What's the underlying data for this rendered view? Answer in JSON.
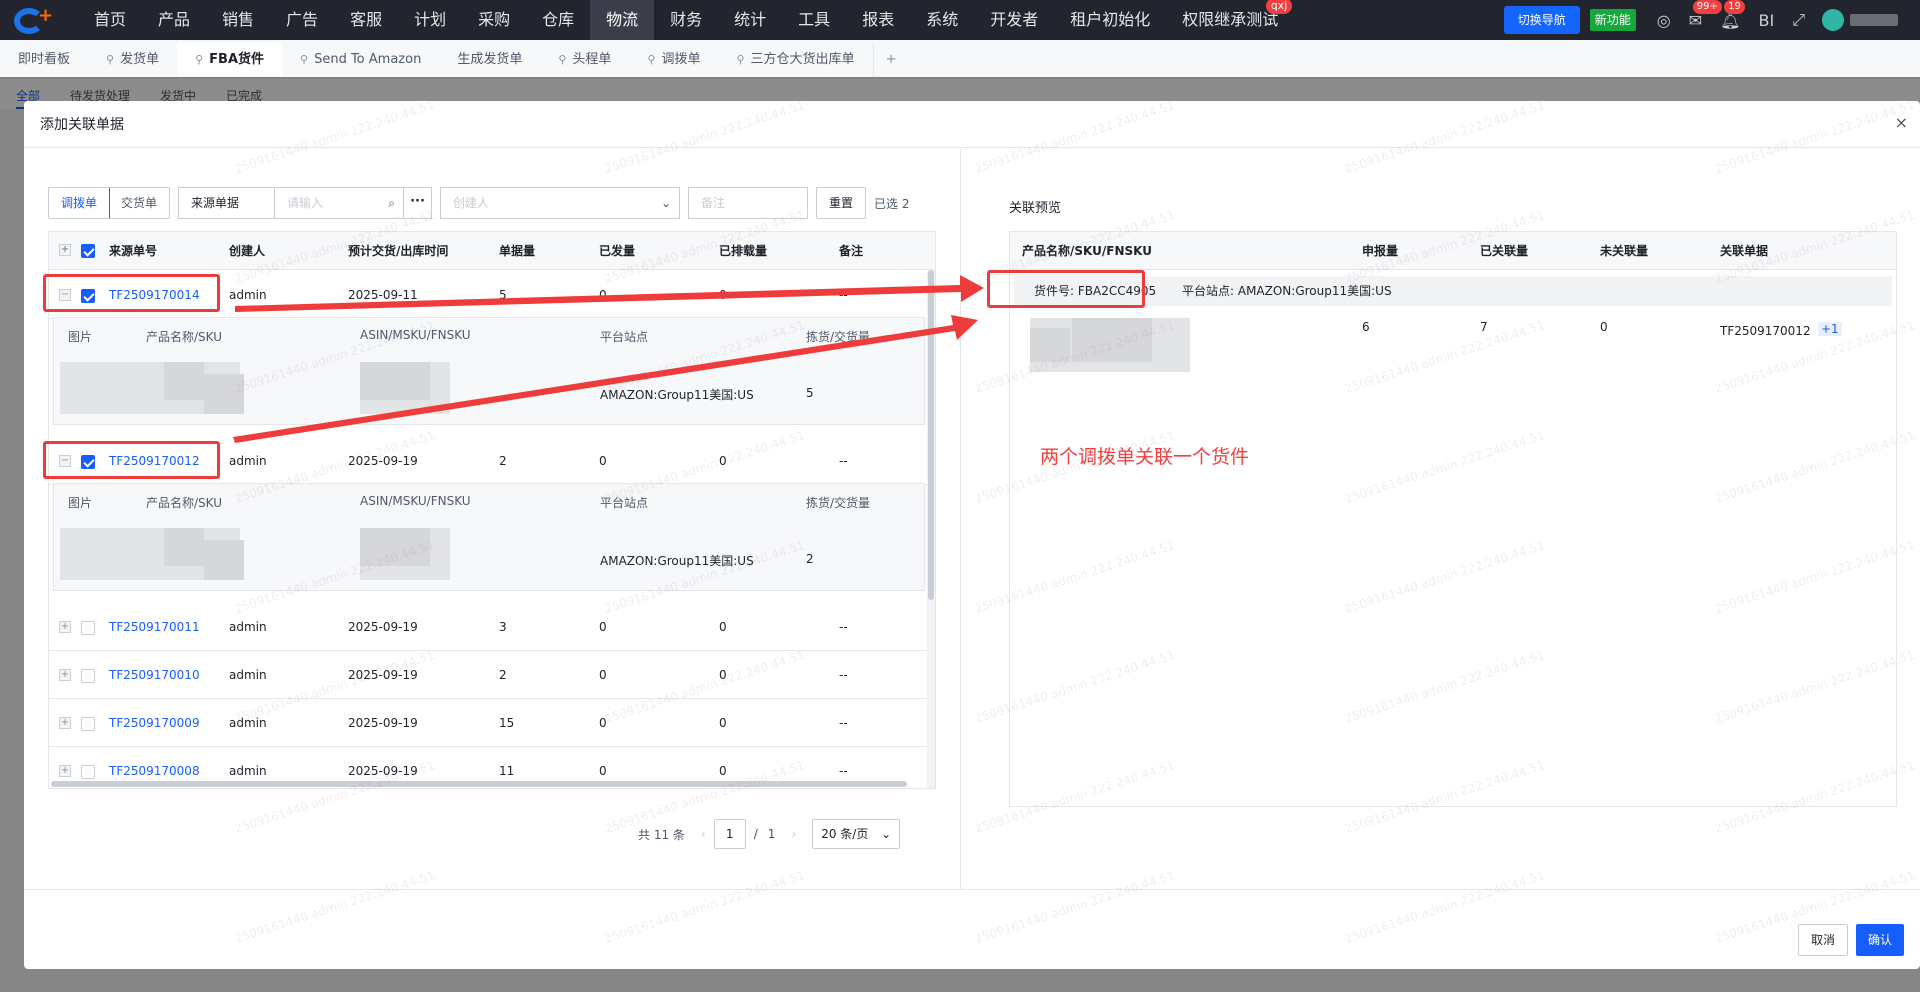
{
  "nav": {
    "menu": [
      {
        "label": "首页"
      },
      {
        "label": "产品"
      },
      {
        "label": "销售"
      },
      {
        "label": "广告"
      },
      {
        "label": "客服"
      },
      {
        "label": "计划"
      },
      {
        "label": "采购"
      },
      {
        "label": "仓库"
      },
      {
        "label": "物流",
        "active": true
      },
      {
        "label": "财务"
      },
      {
        "label": "统计"
      },
      {
        "label": "工具"
      },
      {
        "label": "报表"
      },
      {
        "label": "系统"
      },
      {
        "label": "开发者"
      },
      {
        "label": "租户初始化"
      },
      {
        "label": "权限继承测试",
        "badge": "qxj"
      }
    ],
    "switch_label": "切换导航",
    "new_feature_label": "新功能",
    "msg_badge": "99+",
    "bell_badge": "19",
    "bi_label": "BI"
  },
  "tabs": [
    {
      "label": "即时看板",
      "pinned": false
    },
    {
      "label": "发货单",
      "pinned": true
    },
    {
      "label": "FBA货件",
      "pinned": true,
      "active": true
    },
    {
      "label": "Send To Amazon",
      "pinned": true
    },
    {
      "label": "生成发货单",
      "pinned": false
    },
    {
      "label": "头程单",
      "pinned": true
    },
    {
      "label": "调拨单",
      "pinned": true
    },
    {
      "label": "三方仓大货出库单",
      "pinned": true
    }
  ],
  "tab_add": "+",
  "subtabs": [
    "全部",
    "待发货处理",
    "发货中",
    "已完成"
  ],
  "modal": {
    "title": "添加关联单据",
    "close": "×",
    "filters": {
      "type_options": [
        "调拨单",
        "交货单"
      ],
      "source_label": "来源单据",
      "search_placeholder": "请输入",
      "more": "···",
      "creator_placeholder": "创建人",
      "remark_placeholder": "备注",
      "reset": "重置",
      "selected": "已选 2"
    },
    "columns": [
      "来源单号",
      "创建人",
      "预计交货/出库时间",
      "单据量",
      "已发量",
      "已排载量",
      "备注"
    ],
    "detail_columns": [
      "图片",
      "产品名称/SKU",
      "ASIN/MSKU/FNSKU",
      "平台站点",
      "拣货/交货量"
    ],
    "rows": [
      {
        "id": "TF2509170014",
        "creator": "admin",
        "date": "2025-09-11",
        "qty": "5",
        "sent": "0",
        "loaded": "0",
        "remark": "--",
        "checked": true,
        "expanded": true,
        "site": "AMAZON:Group11美国:US",
        "pick": "5"
      },
      {
        "id": "TF2509170012",
        "creator": "admin",
        "date": "2025-09-19",
        "qty": "2",
        "sent": "0",
        "loaded": "0",
        "remark": "--",
        "checked": true,
        "expanded": true,
        "site": "AMAZON:Group11美国:US",
        "pick": "2"
      },
      {
        "id": "TF2509170011",
        "creator": "admin",
        "date": "2025-09-19",
        "qty": "3",
        "sent": "0",
        "loaded": "0",
        "remark": "--",
        "checked": false
      },
      {
        "id": "TF2509170010",
        "creator": "admin",
        "date": "2025-09-19",
        "qty": "2",
        "sent": "0",
        "loaded": "0",
        "remark": "--",
        "checked": false
      },
      {
        "id": "TF2509170009",
        "creator": "admin",
        "date": "2025-09-19",
        "qty": "15",
        "sent": "0",
        "loaded": "0",
        "remark": "--",
        "checked": false
      },
      {
        "id": "TF2509170008",
        "creator": "admin",
        "date": "2025-09-19",
        "qty": "11",
        "sent": "0",
        "loaded": "0",
        "remark": "--",
        "checked": false
      }
    ],
    "pager": {
      "total": "共 11 条",
      "page": "1",
      "sep": "/",
      "pages": "1",
      "size": "20 条/页",
      "prev": "‹",
      "next": "›"
    },
    "preview": {
      "title": "关联预览",
      "columns": [
        "产品名称/SKU/FNSKU",
        "申报量",
        "已关联量",
        "未关联量",
        "关联单据"
      ],
      "shipment": "货件号: FBA2CC4905",
      "site": "平台站点: AMAZON:Group11美国:US",
      "declared": "6",
      "linked": "7",
      "unlinked": "0",
      "doc": "TF2509170012",
      "doc_more": "+1"
    },
    "annotation": "两个调拨单关联一个货件",
    "cancel": "取消",
    "confirm": "确认"
  },
  "watermark": "2509161440 admin 222.240.44.51",
  "colors": {
    "nav_bg": "#23252e",
    "primary": "#165dff",
    "annotation": "#ee3b3b"
  }
}
